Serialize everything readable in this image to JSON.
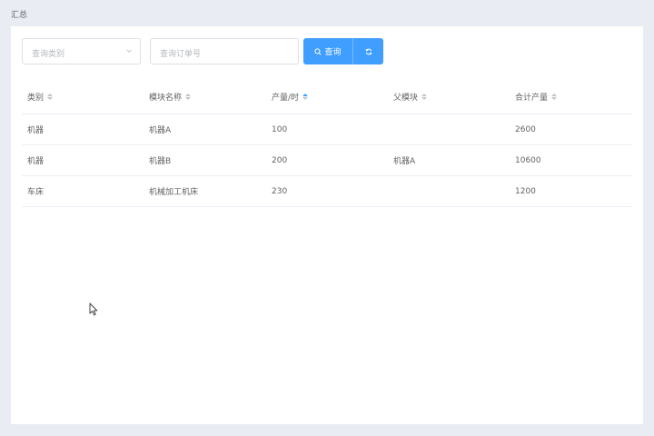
{
  "page": {
    "title": "汇总"
  },
  "filters": {
    "category_placeholder": "查询类别",
    "order_placeholder": "查询订单号",
    "search_label": "查询"
  },
  "table": {
    "columns": [
      {
        "label": "类别",
        "sort": "none"
      },
      {
        "label": "模块名称",
        "sort": "none"
      },
      {
        "label": "产量/时",
        "sort": "ascending"
      },
      {
        "label": "父模块",
        "sort": "none"
      },
      {
        "label": "合计产量",
        "sort": "none"
      }
    ],
    "rows": [
      [
        "机器",
        "机器A",
        "100",
        "",
        "2600"
      ],
      [
        "机器",
        "机器B",
        "200",
        "机器A",
        "10600"
      ],
      [
        "车床",
        "机械加工机床",
        "230",
        "",
        "1200"
      ]
    ]
  },
  "colors": {
    "primary": "#409eff",
    "background": "#e9ecf2",
    "border": "#dcdfe6"
  },
  "icons": {
    "search": "search-icon",
    "refresh": "refresh-icon",
    "chevron": "chevron-down-icon",
    "cursor": "mouse-pointer-icon"
  }
}
